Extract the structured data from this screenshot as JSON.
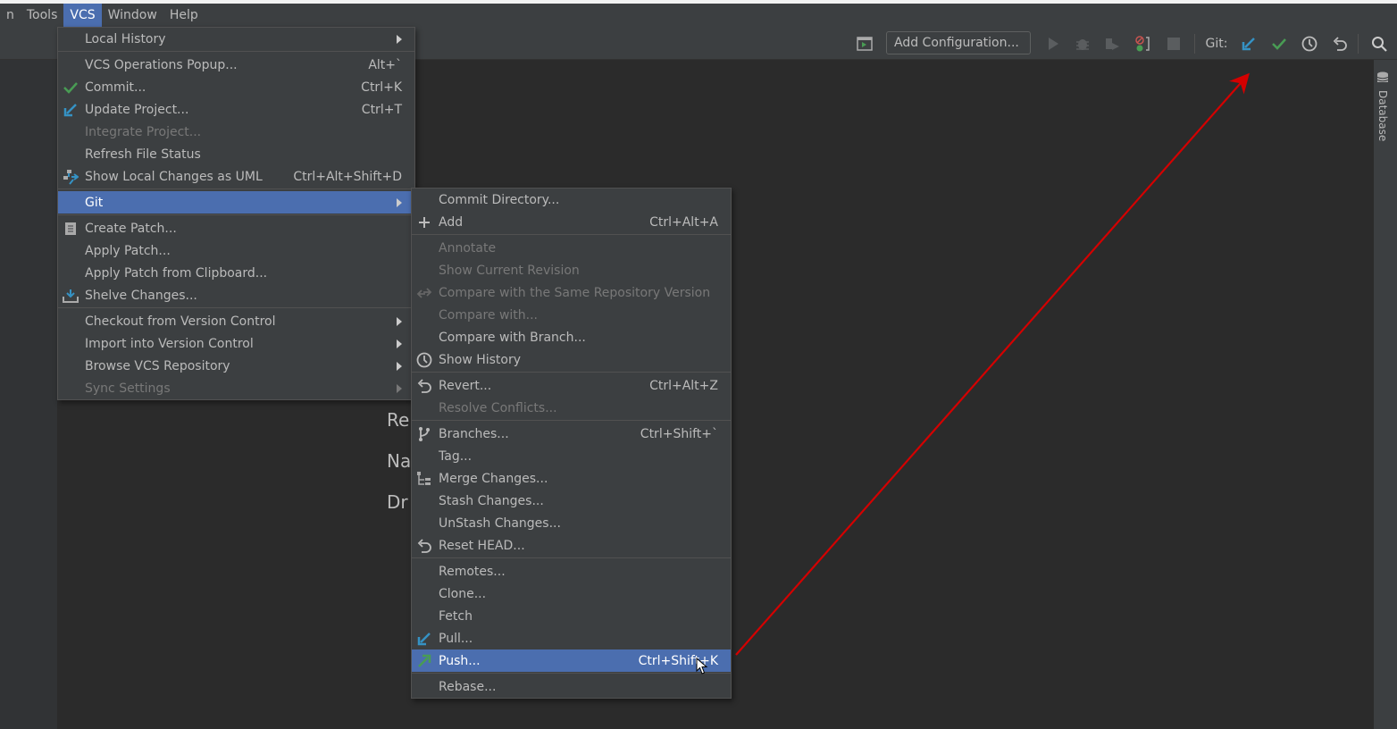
{
  "menubar": [
    {
      "label": "n",
      "active": false
    },
    {
      "label": "Tools",
      "active": false
    },
    {
      "label": "VCS",
      "active": true
    },
    {
      "label": "Window",
      "active": false
    },
    {
      "label": "Help",
      "active": false
    }
  ],
  "toolbar": {
    "add_configuration": "Add Configuration...",
    "git_label": "Git:",
    "icons": [
      "run-config-icon",
      "run-icon",
      "debug-icon",
      "coverage-icon",
      "profiler-icon",
      "stop-icon",
      "git-update-icon",
      "git-commit-icon",
      "git-history-icon",
      "git-rollback-icon",
      "search-icon"
    ]
  },
  "right_sidebar": {
    "database_label": "Database"
  },
  "editor_background_text": [
    "Re",
    "Na",
    "Dr"
  ],
  "colors": {
    "highlight": "#4b6eaf",
    "menu_bg": "#3c3f41",
    "editor_bg": "#2b2b2b",
    "annotation_arrow": "#d40000",
    "green": "#499c54",
    "blue": "#3592c4"
  },
  "vcs_menu": [
    {
      "label": "Local History",
      "submenu": true
    },
    {
      "sep": true
    },
    {
      "label": "VCS Operations Popup...",
      "shortcut": "Alt+`"
    },
    {
      "label": "Commit...",
      "shortcut": "Ctrl+K",
      "icon": "commit-check-icon"
    },
    {
      "label": "Update Project...",
      "shortcut": "Ctrl+T",
      "icon": "update-arrow-icon"
    },
    {
      "label": "Integrate Project...",
      "disabled": true
    },
    {
      "label": "Refresh File Status"
    },
    {
      "label": "Show Local Changes as UML",
      "shortcut": "Ctrl+Alt+Shift+D",
      "icon": "uml-icon"
    },
    {
      "sep": true
    },
    {
      "label": "Git",
      "submenu": true,
      "highlighted": true
    },
    {
      "sep": true
    },
    {
      "label": "Create Patch...",
      "icon": "patch-icon"
    },
    {
      "label": "Apply Patch..."
    },
    {
      "label": "Apply Patch from Clipboard..."
    },
    {
      "label": "Shelve Changes...",
      "icon": "shelve-icon"
    },
    {
      "sep": true
    },
    {
      "label": "Checkout from Version Control",
      "submenu": true
    },
    {
      "label": "Import into Version Control",
      "submenu": true
    },
    {
      "label": "Browse VCS Repository",
      "submenu": true
    },
    {
      "label": "Sync Settings",
      "submenu": true,
      "disabled": true
    }
  ],
  "git_menu": [
    {
      "label": "Commit Directory..."
    },
    {
      "label": "Add",
      "shortcut": "Ctrl+Alt+A",
      "icon": "plus-icon"
    },
    {
      "sep": true
    },
    {
      "label": "Annotate",
      "disabled": true
    },
    {
      "label": "Show Current Revision",
      "disabled": true
    },
    {
      "label": "Compare with the Same Repository Version",
      "disabled": true,
      "icon": "compare-icon"
    },
    {
      "label": "Compare with...",
      "disabled": true
    },
    {
      "label": "Compare with Branch..."
    },
    {
      "label": "Show History",
      "icon": "clock-icon"
    },
    {
      "sep": true
    },
    {
      "label": "Revert...",
      "shortcut": "Ctrl+Alt+Z",
      "icon": "revert-icon"
    },
    {
      "label": "Resolve Conflicts...",
      "disabled": true
    },
    {
      "sep": true
    },
    {
      "label": "Branches...",
      "shortcut": "Ctrl+Shift+`",
      "icon": "branch-icon"
    },
    {
      "label": "Tag..."
    },
    {
      "label": "Merge Changes...",
      "icon": "merge-icon"
    },
    {
      "label": "Stash Changes..."
    },
    {
      "label": "UnStash Changes..."
    },
    {
      "label": "Reset HEAD...",
      "icon": "reset-icon"
    },
    {
      "sep": true
    },
    {
      "label": "Remotes..."
    },
    {
      "label": "Clone..."
    },
    {
      "label": "Fetch"
    },
    {
      "label": "Pull...",
      "icon": "pull-arrow-icon"
    },
    {
      "label": "Push...",
      "shortcut": "Ctrl+Shift+K",
      "icon": "push-arrow-icon",
      "highlighted": true
    },
    {
      "sep": true
    },
    {
      "label": "Rebase..."
    }
  ]
}
